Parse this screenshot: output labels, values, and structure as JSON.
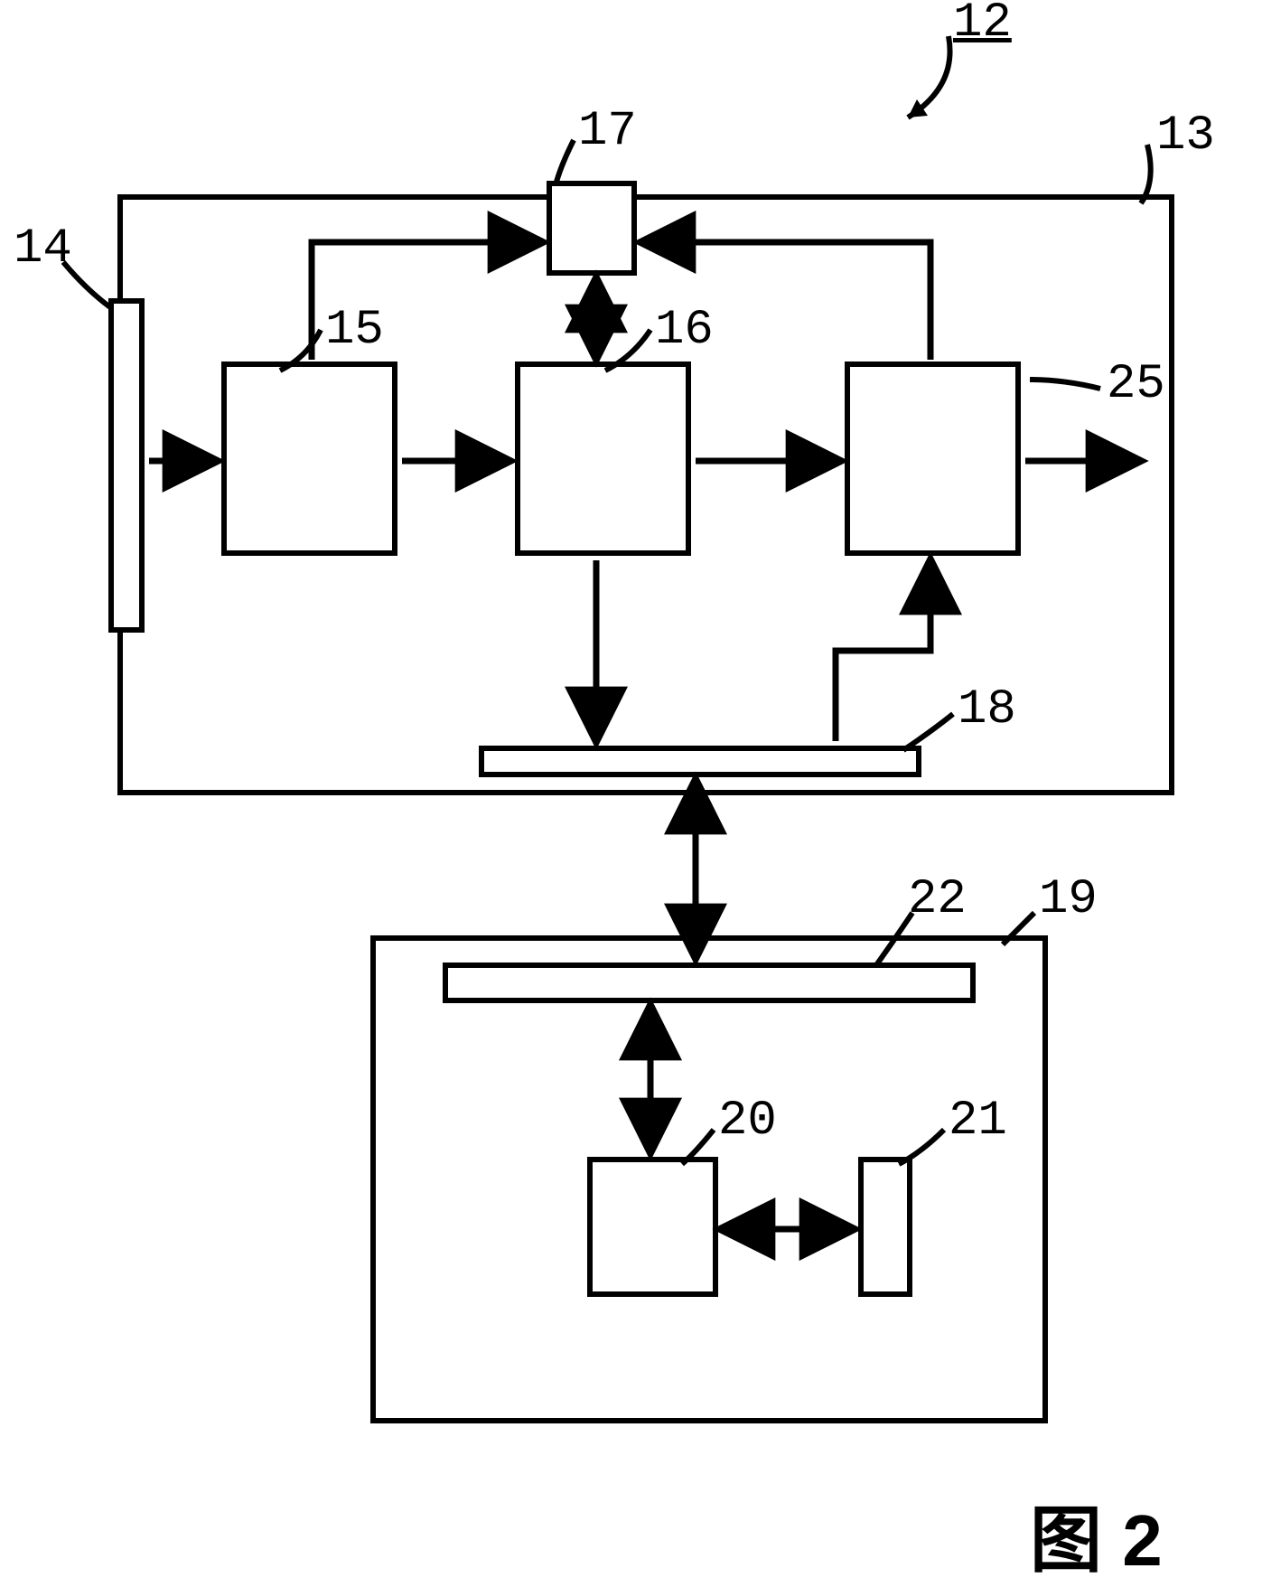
{
  "figure_label": "图 2",
  "labels": {
    "l12": "12",
    "l13": "13",
    "l14": "14",
    "l15": "15",
    "l16": "16",
    "l17": "17",
    "l18": "18",
    "l19": "19",
    "l20": "20",
    "l21": "21",
    "l22": "22",
    "l25": "25"
  }
}
